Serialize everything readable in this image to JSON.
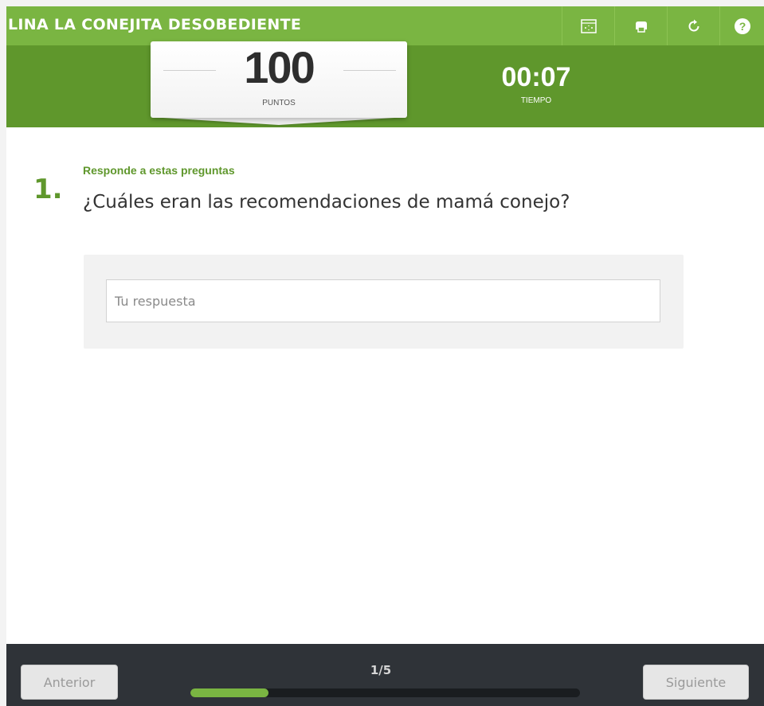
{
  "app": {
    "title": "LINA LA CONEJITA DESOBEDIENTE"
  },
  "toolbar": {
    "icons": [
      "fullscreen-icon",
      "print-icon",
      "restart-icon",
      "help-icon"
    ]
  },
  "score": {
    "points": "100",
    "points_label": "PUNTOS",
    "time": "00:07",
    "time_label": "TIEMPO"
  },
  "question": {
    "number": "1.",
    "instruction": "Responde a estas preguntas",
    "text": "¿Cuáles eran las recomendaciones de mamá conejo?",
    "answer_placeholder": "Tu respuesta",
    "answer_value": ""
  },
  "footer": {
    "prev_label": "Anterior",
    "next_label": "Siguiente",
    "page_indicator": "1/5",
    "progress": 0.2
  },
  "colors": {
    "accent_light": "#7ab542",
    "accent_dark": "#5f972c",
    "footer_bg": "#2f3338"
  }
}
